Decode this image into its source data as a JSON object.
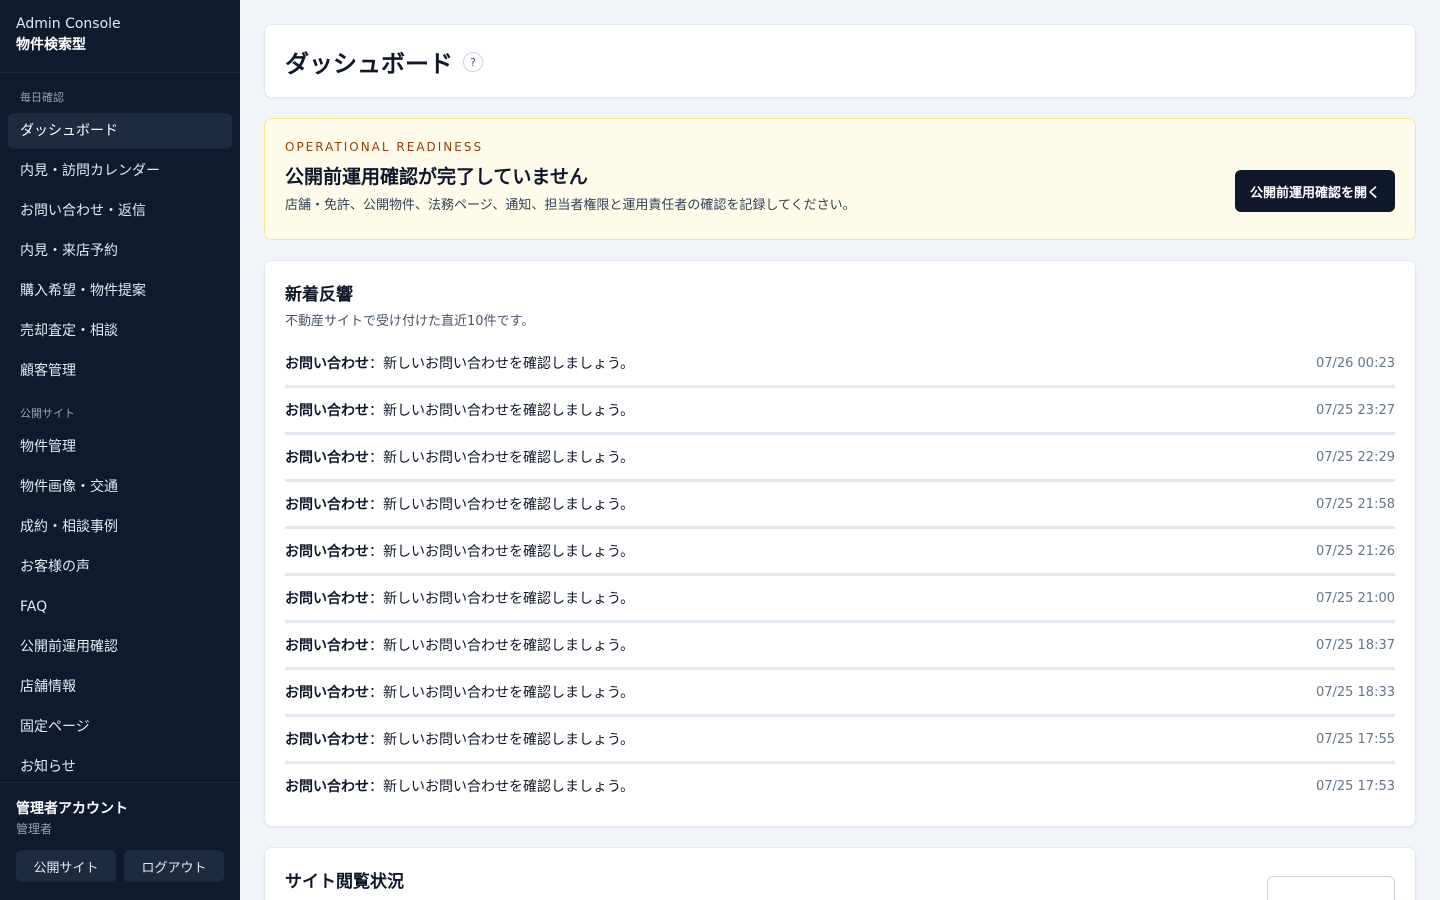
{
  "sidebar": {
    "brand_line1": "Admin Console",
    "brand_line2": "物件検索型",
    "groups": [
      {
        "label": "毎日確認",
        "items": [
          {
            "label": "ダッシュボード",
            "active": true
          },
          {
            "label": "内見・訪問カレンダー"
          },
          {
            "label": "お問い合わせ・返信"
          },
          {
            "label": "内見・来店予約"
          },
          {
            "label": "購入希望・物件提案"
          },
          {
            "label": "売却査定・相談"
          },
          {
            "label": "顧客管理"
          }
        ]
      },
      {
        "label": "公開サイト",
        "items": [
          {
            "label": "物件管理"
          },
          {
            "label": "物件画像・交通"
          },
          {
            "label": "成約・相談事例"
          },
          {
            "label": "お客様の声"
          },
          {
            "label": "FAQ"
          },
          {
            "label": "公開前運用確認"
          },
          {
            "label": "店舗情報"
          },
          {
            "label": "固定ページ"
          },
          {
            "label": "お知らせ"
          }
        ]
      }
    ],
    "account": {
      "name": "管理者アカウント",
      "role": "管理者",
      "public_site_label": "公開サイト",
      "logout_label": "ログアウト"
    }
  },
  "header": {
    "title": "ダッシュボード",
    "help_icon": "?"
  },
  "readiness": {
    "kicker": "OPERATIONAL READINESS",
    "title": "公開前運用確認が完了していません",
    "description": "店舗・免許、公開物件、法務ページ、通知、担当者権限と運用責任者の確認を記録してください。",
    "button_label": "公開前運用確認を開く"
  },
  "feed": {
    "title": "新着反響",
    "subtitle": "不動産サイトで受け付けた直近10件です。",
    "separator": "：",
    "items": [
      {
        "kind": "お問い合わせ",
        "message": "新しいお問い合わせを確認しましょう。",
        "time": "07/26 00:23"
      },
      {
        "kind": "お問い合わせ",
        "message": "新しいお問い合わせを確認しましょう。",
        "time": "07/25 23:27"
      },
      {
        "kind": "お問い合わせ",
        "message": "新しいお問い合わせを確認しましょう。",
        "time": "07/25 22:29"
      },
      {
        "kind": "お問い合わせ",
        "message": "新しいお問い合わせを確認しましょう。",
        "time": "07/25 21:58"
      },
      {
        "kind": "お問い合わせ",
        "message": "新しいお問い合わせを確認しましょう。",
        "time": "07/25 21:26"
      },
      {
        "kind": "お問い合わせ",
        "message": "新しいお問い合わせを確認しましょう。",
        "time": "07/25 21:00"
      },
      {
        "kind": "お問い合わせ",
        "message": "新しいお問い合わせを確認しましょう。",
        "time": "07/25 18:37"
      },
      {
        "kind": "お問い合わせ",
        "message": "新しいお問い合わせを確認しましょう。",
        "time": "07/25 18:33"
      },
      {
        "kind": "お問い合わせ",
        "message": "新しいお問い合わせを確認しましょう。",
        "time": "07/25 17:55"
      },
      {
        "kind": "お問い合わせ",
        "message": "新しいお問い合わせを確認しましょう。",
        "time": "07/25 17:53"
      }
    ]
  },
  "site_views": {
    "title": "サイト閲覧状況"
  }
}
